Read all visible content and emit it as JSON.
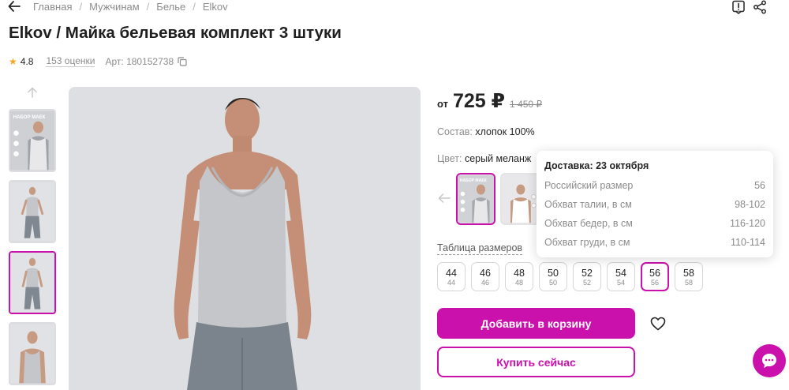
{
  "breadcrumb": [
    "Главная",
    "Мужчинам",
    "Белье",
    "Elkov"
  ],
  "product": {
    "title": "Elkov / Майка бельевая комплект 3 штуки",
    "rating": "4.8",
    "reviews": "153 оценки",
    "article": "Арт: 180152738"
  },
  "price": {
    "from": "от",
    "current": "725 ₽",
    "old": "1 450 ₽"
  },
  "composition": {
    "label": "Состав:",
    "value": "хлопок 100%"
  },
  "color": {
    "label": "Цвет:",
    "value": "серый меланж"
  },
  "size_table_label": "Таблица размеров",
  "sizes": [
    {
      "main": "44",
      "sub": "44"
    },
    {
      "main": "46",
      "sub": "46"
    },
    {
      "main": "48",
      "sub": "48"
    },
    {
      "main": "50",
      "sub": "50"
    },
    {
      "main": "52",
      "sub": "52"
    },
    {
      "main": "54",
      "sub": "54"
    },
    {
      "main": "56",
      "sub": "56"
    },
    {
      "main": "58",
      "sub": "58"
    }
  ],
  "selected_size": "56",
  "tooltip": {
    "title": "Доставка: 23 октября",
    "rows": [
      {
        "label": "Российский размер",
        "value": "56"
      },
      {
        "label": "Обхват талии, в см",
        "value": "98-102"
      },
      {
        "label": "Обхват бедер, в см",
        "value": "116-120"
      },
      {
        "label": "Обхват груди, в см",
        "value": "110-114"
      }
    ]
  },
  "buttons": {
    "add_to_cart": "Добавить в корзину",
    "buy_now": "Купить сейчас"
  },
  "thumb_badge": "НАБОР МАЕК",
  "colors": {
    "accent": "#cb11ab",
    "muted": "#8c8c8c",
    "text": "#242424"
  },
  "icons": [
    "back-arrow-icon",
    "report-icon",
    "share-icon",
    "star-icon",
    "copy-icon",
    "arrow-up-icon",
    "arrow-left-icon",
    "heart-icon",
    "chat-icon"
  ]
}
